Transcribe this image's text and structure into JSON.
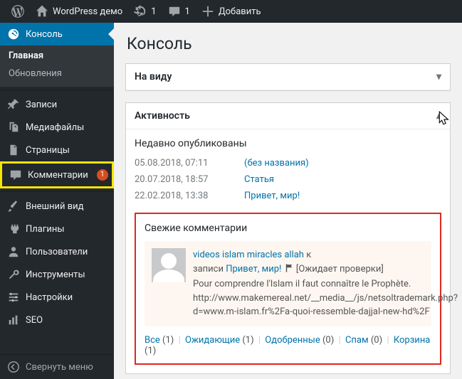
{
  "adminbar": {
    "site_name": "WordPress демо",
    "updates": "1",
    "comments": "1",
    "add_new": "Добавить"
  },
  "sidebar": {
    "dashboard": "Консоль",
    "sub_home": "Главная",
    "sub_updates": "Обновления",
    "posts": "Записи",
    "media": "Медиафайлы",
    "pages": "Страницы",
    "comments": "Комментарии",
    "comments_badge": "1",
    "appearance": "Внешний вид",
    "plugins": "Плагины",
    "users": "Пользователи",
    "tools": "Инструменты",
    "settings": "Настройки",
    "seo": "SEO",
    "collapse": "Свернуть меню"
  },
  "page": {
    "title": "Консоль",
    "glance_title": "На виду",
    "activity_title": "Активность",
    "recent_pub": "Недавно опубликованы",
    "posts": [
      {
        "date": "05.08.2018, 07:11",
        "title": "(без названия)"
      },
      {
        "date": "20.07.2018, 18:57",
        "title": "Статья"
      },
      {
        "date": "22.02.2018, 13:38",
        "title": "Привет, мир!"
      }
    ],
    "recent_comments_title": "Свежие комментарии",
    "comment": {
      "author": "videos islam miracles allah",
      "to": "к",
      "on_word": "записи",
      "post": "Привет, мир!",
      "status": "[Ожидает проверки]",
      "body1": "Pour comprendre l'Islam il faut connaître le Prophète.",
      "body2": "http://www.makemereal.net/__media__/js/netsoltrademark.php?d=www.m-islam.fr%2Fa-quoi-ressemble-dajjal-new-hd%2F"
    },
    "filters": {
      "all": "Все",
      "all_n": "(1)",
      "pending": "Ожидающие",
      "pending_n": "(1)",
      "approved": "Одобренные",
      "approved_n": "(0)",
      "spam": "Спам",
      "spam_n": "(0)",
      "trash": "Корзина",
      "trash_n": "(1)"
    }
  }
}
